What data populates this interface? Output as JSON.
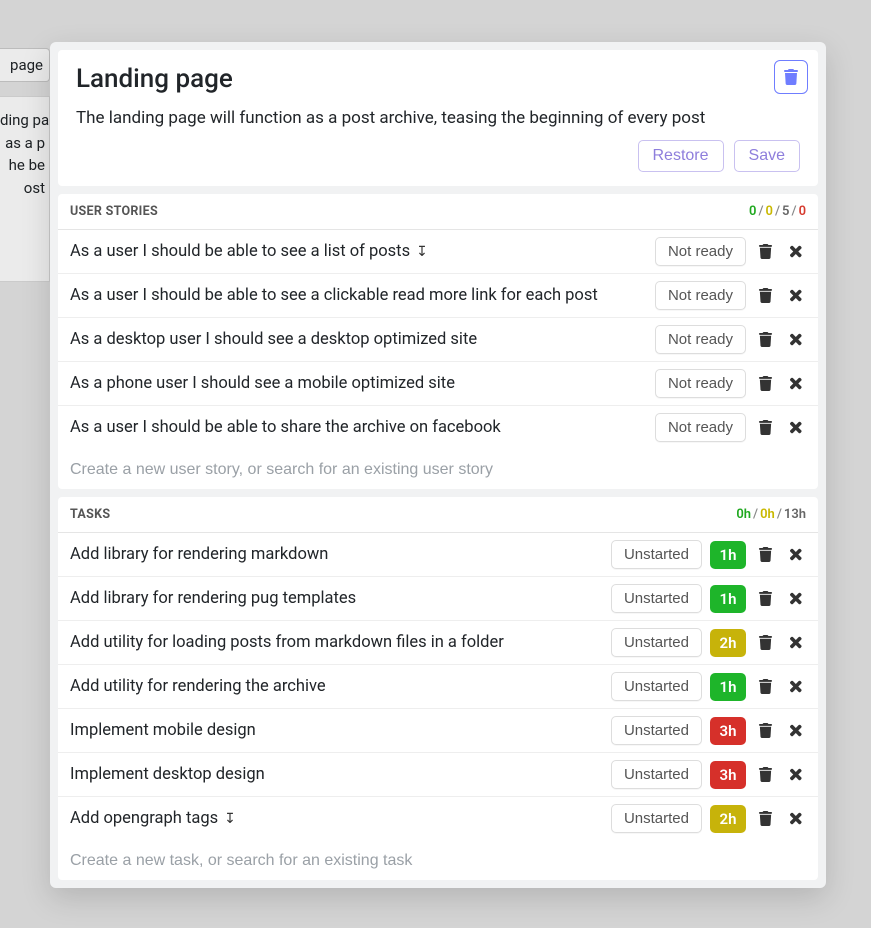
{
  "background": {
    "tab_label": "page",
    "card_lines": [
      "ding pa",
      "as a p",
      "he be",
      "ost"
    ]
  },
  "header": {
    "title": "Landing page",
    "description": "The landing page will function as a post archive, teasing the beginning of every post",
    "restore_label": "Restore",
    "save_label": "Save"
  },
  "user_stories_section": {
    "title": "USER STORIES",
    "counts": {
      "green": "0",
      "yellow": "0",
      "gray": "5",
      "red": "0"
    },
    "not_ready_label": "Not ready",
    "rows": [
      {
        "text": "As a user I should be able to see a list of posts",
        "has_children": true
      },
      {
        "text": "As a user I should be able to see a clickable read more link for each post",
        "has_children": false
      },
      {
        "text": "As a desktop user I should see a desktop optimized site",
        "has_children": false
      },
      {
        "text": "As a phone user I should see a mobile optimized site",
        "has_children": false
      },
      {
        "text": "As a user I should be able to share the archive on facebook",
        "has_children": false
      }
    ],
    "new_placeholder": "Create a new user story, or search for an existing user story"
  },
  "tasks_section": {
    "title": "TASKS",
    "counts": {
      "green": "0h",
      "yellow": "0h",
      "gray": "13h"
    },
    "unstarted_label": "Unstarted",
    "rows": [
      {
        "text": "Add library for rendering markdown",
        "hours": "1h",
        "color": "green",
        "has_children": false
      },
      {
        "text": "Add library for rendering pug templates",
        "hours": "1h",
        "color": "green",
        "has_children": false
      },
      {
        "text": "Add utility for loading posts from markdown files in a folder",
        "hours": "2h",
        "color": "yellow",
        "has_children": false
      },
      {
        "text": "Add utility for rendering the archive",
        "hours": "1h",
        "color": "green",
        "has_children": false
      },
      {
        "text": "Implement mobile design",
        "hours": "3h",
        "color": "red",
        "has_children": false
      },
      {
        "text": "Implement desktop design",
        "hours": "3h",
        "color": "red",
        "has_children": false
      },
      {
        "text": "Add opengraph tags",
        "hours": "2h",
        "color": "yellow",
        "has_children": true
      }
    ],
    "new_placeholder": "Create a new task, or search for an existing task"
  }
}
